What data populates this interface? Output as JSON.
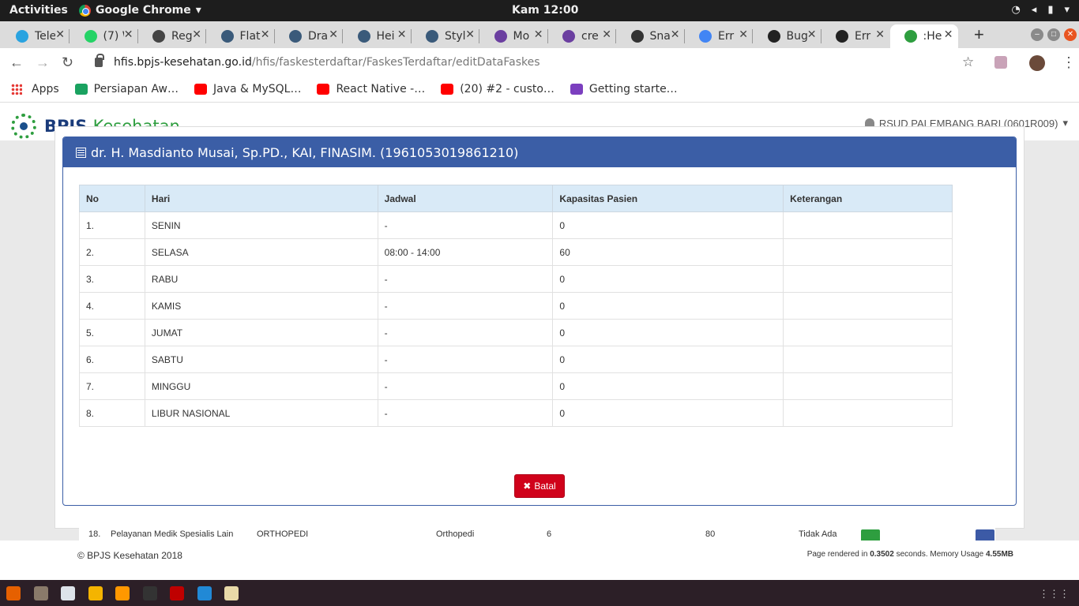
{
  "system": {
    "activities": "Activities",
    "app_name": "Google Chrome",
    "app_caret": "▾",
    "clock": "Kam 12:00"
  },
  "tabs": [
    {
      "title": "Tele",
      "color": "#2aa3e0"
    },
    {
      "title": "(7) W",
      "color": "#25d366"
    },
    {
      "title": "Reg",
      "color": "#444444"
    },
    {
      "title": "Flat",
      "color": "#3a5a7a"
    },
    {
      "title": "Dra",
      "color": "#3a5a7a"
    },
    {
      "title": "Hei",
      "color": "#3a5a7a"
    },
    {
      "title": "Styl",
      "color": "#3a5a7a"
    },
    {
      "title": "Mo",
      "color": "#6b3fa0"
    },
    {
      "title": "cre",
      "color": "#6b3fa0"
    },
    {
      "title": "Sna",
      "color": "#333333"
    },
    {
      "title": "Err",
      "color": "#4285f4"
    },
    {
      "title": "Bug",
      "color": "#222222"
    },
    {
      "title": "Err",
      "color": "#222222"
    },
    {
      "title": ":He",
      "color": "#2e9e3f"
    }
  ],
  "address": {
    "host": "hfis.bpjs-kesehatan.go.id",
    "path": "/hfis/faskesterdaftar/FaskesTerdaftar/editDataFaskes"
  },
  "bookmarks": [
    {
      "label": "Apps",
      "color": "#e53935"
    },
    {
      "label": "Persiapan Aw…",
      "color": "#1aa260"
    },
    {
      "label": "Java & MySQL…",
      "color": "#ff0000"
    },
    {
      "label": "React Native -…",
      "color": "#ff0000"
    },
    {
      "label": "(20) #2 - custo…",
      "color": "#ff0000"
    },
    {
      "label": "Getting starte…",
      "color": "#7b3fbf"
    }
  ],
  "site": {
    "logo_bold": "BPJS",
    "logo_light": "Kesehatan",
    "user": "RSUD PALEMBANG BARI (0601R009)"
  },
  "modal": {
    "title": "dr. H. Masdianto Musai, Sp.PD., KAI, FINASIM. (1961053019861210)",
    "headers": [
      "No",
      "Hari",
      "Jadwal",
      "Kapasitas Pasien",
      "Keterangan"
    ],
    "rows": [
      [
        "1.",
        "SENIN",
        "-",
        "0",
        ""
      ],
      [
        "2.",
        "SELASA",
        "08:00 - 14:00",
        "60",
        ""
      ],
      [
        "3.",
        "RABU",
        "-",
        "0",
        ""
      ],
      [
        "4.",
        "KAMIS",
        "-",
        "0",
        ""
      ],
      [
        "5.",
        "JUMAT",
        "-",
        "0",
        ""
      ],
      [
        "6.",
        "SABTU",
        "-",
        "0",
        ""
      ],
      [
        "7.",
        "MINGGU",
        "-",
        "0",
        ""
      ],
      [
        "8.",
        "LIBUR NASIONAL",
        "-",
        "0",
        ""
      ]
    ],
    "cancel_label": "Batal",
    "cancel_icon": "✖"
  },
  "background_row": {
    "no": "18.",
    "layanan": "Pelayanan Medik Spesialis Lain",
    "poli": "ORTHOPEDI",
    "nama": "Orthopedi",
    "a": "6",
    "b": "80",
    "status": "Tidak Ada"
  },
  "footer": {
    "copyright": "© BPJS Kesehatan 2018",
    "render_prefix": "Page rendered in ",
    "render_time": "0.3502",
    "render_mid": " seconds. Memory Usage ",
    "memory": "4.55MB"
  },
  "dock": [
    {
      "name": "firefox",
      "color": "#e66000"
    },
    {
      "name": "files",
      "color": "#8a7a6a"
    },
    {
      "name": "text-editor",
      "color": "#dde3ea"
    },
    {
      "name": "chrome",
      "color": "#f4b400"
    },
    {
      "name": "sublime",
      "color": "#ff9800"
    },
    {
      "name": "terminal",
      "color": "#333333"
    },
    {
      "name": "filezilla",
      "color": "#bf0000"
    },
    {
      "name": "vscode",
      "color": "#2189d6"
    },
    {
      "name": "notes",
      "color": "#e8d9a8"
    }
  ]
}
